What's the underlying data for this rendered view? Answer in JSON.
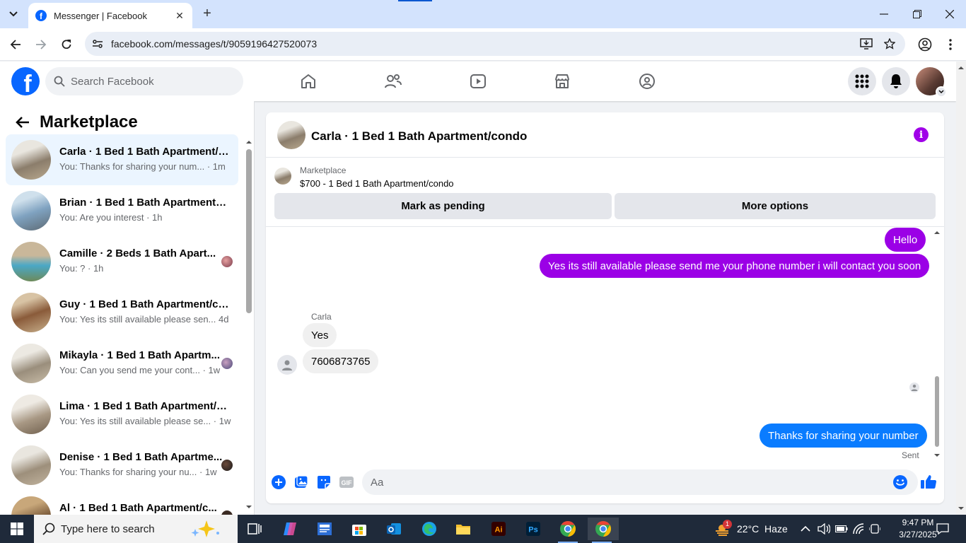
{
  "browser": {
    "tab_title": "Messenger | Facebook",
    "url": "facebook.com/messages/t/9059196427520073",
    "accent": "#0b57d0"
  },
  "fb": {
    "logo_letter": "f",
    "search_placeholder": "Search Facebook",
    "brand_color": "#0866ff"
  },
  "marketplace": {
    "title": "Marketplace",
    "conversations": [
      {
        "name": "Carla · 1 Bed 1 Bath Apartment/c...",
        "snippet": "You: Thanks for sharing your num... · 1m",
        "active": true
      },
      {
        "name": "Brian · 1 Bed 1 Bath Apartment/c...",
        "snippet": "You: Are you interest · 1h"
      },
      {
        "name": "Camille · 2 Beds 1 Bath Apart...",
        "snippet": "You: ? · 1h"
      },
      {
        "name": "Guy · 1 Bed 1 Bath Apartment/co...",
        "snippet": "You: Yes its still available please sen... 4d"
      },
      {
        "name": "Mikayla · 1 Bed 1 Bath Apartm...",
        "snippet": "You: Can you send me your cont... · 1w"
      },
      {
        "name": "Lima · 1 Bed 1 Bath Apartment/c...",
        "snippet": "You: Yes its still available please se... · 1w"
      },
      {
        "name": "Denise · 1 Bed 1 Bath Apartme...",
        "snippet": "You: Thanks for sharing your nu... · 1w"
      },
      {
        "name": "Al · 1 Bed 1 Bath Apartment/c...",
        "snippet": ""
      }
    ]
  },
  "chat": {
    "title": "Carla · 1 Bed 1 Bath Apartment/condo",
    "listing_category": "Marketplace",
    "listing_price": "$700 - 1 Bed 1 Bath Apartment/condo",
    "mark_pending": "Mark as pending",
    "more_options": "More options",
    "messages": [
      {
        "from": "me",
        "text": "Hello"
      },
      {
        "from": "me",
        "text": "Yes its still available please send me your phone number i will contact you soon"
      },
      {
        "from": "Carla",
        "text": "Yes"
      },
      {
        "from": "Carla",
        "text": "7606873765"
      },
      {
        "from": "me",
        "text": "Thanks for sharing your number"
      }
    ],
    "sender_name": "Carla",
    "status": "Sent",
    "composer_placeholder": "Aa",
    "gif_label": "GIF"
  },
  "taskbar": {
    "search_placeholder": "Type here to search",
    "weather": "22°C  Haze",
    "weather_badge": "1",
    "time": "9:47 PM",
    "date": "3/27/2025"
  }
}
